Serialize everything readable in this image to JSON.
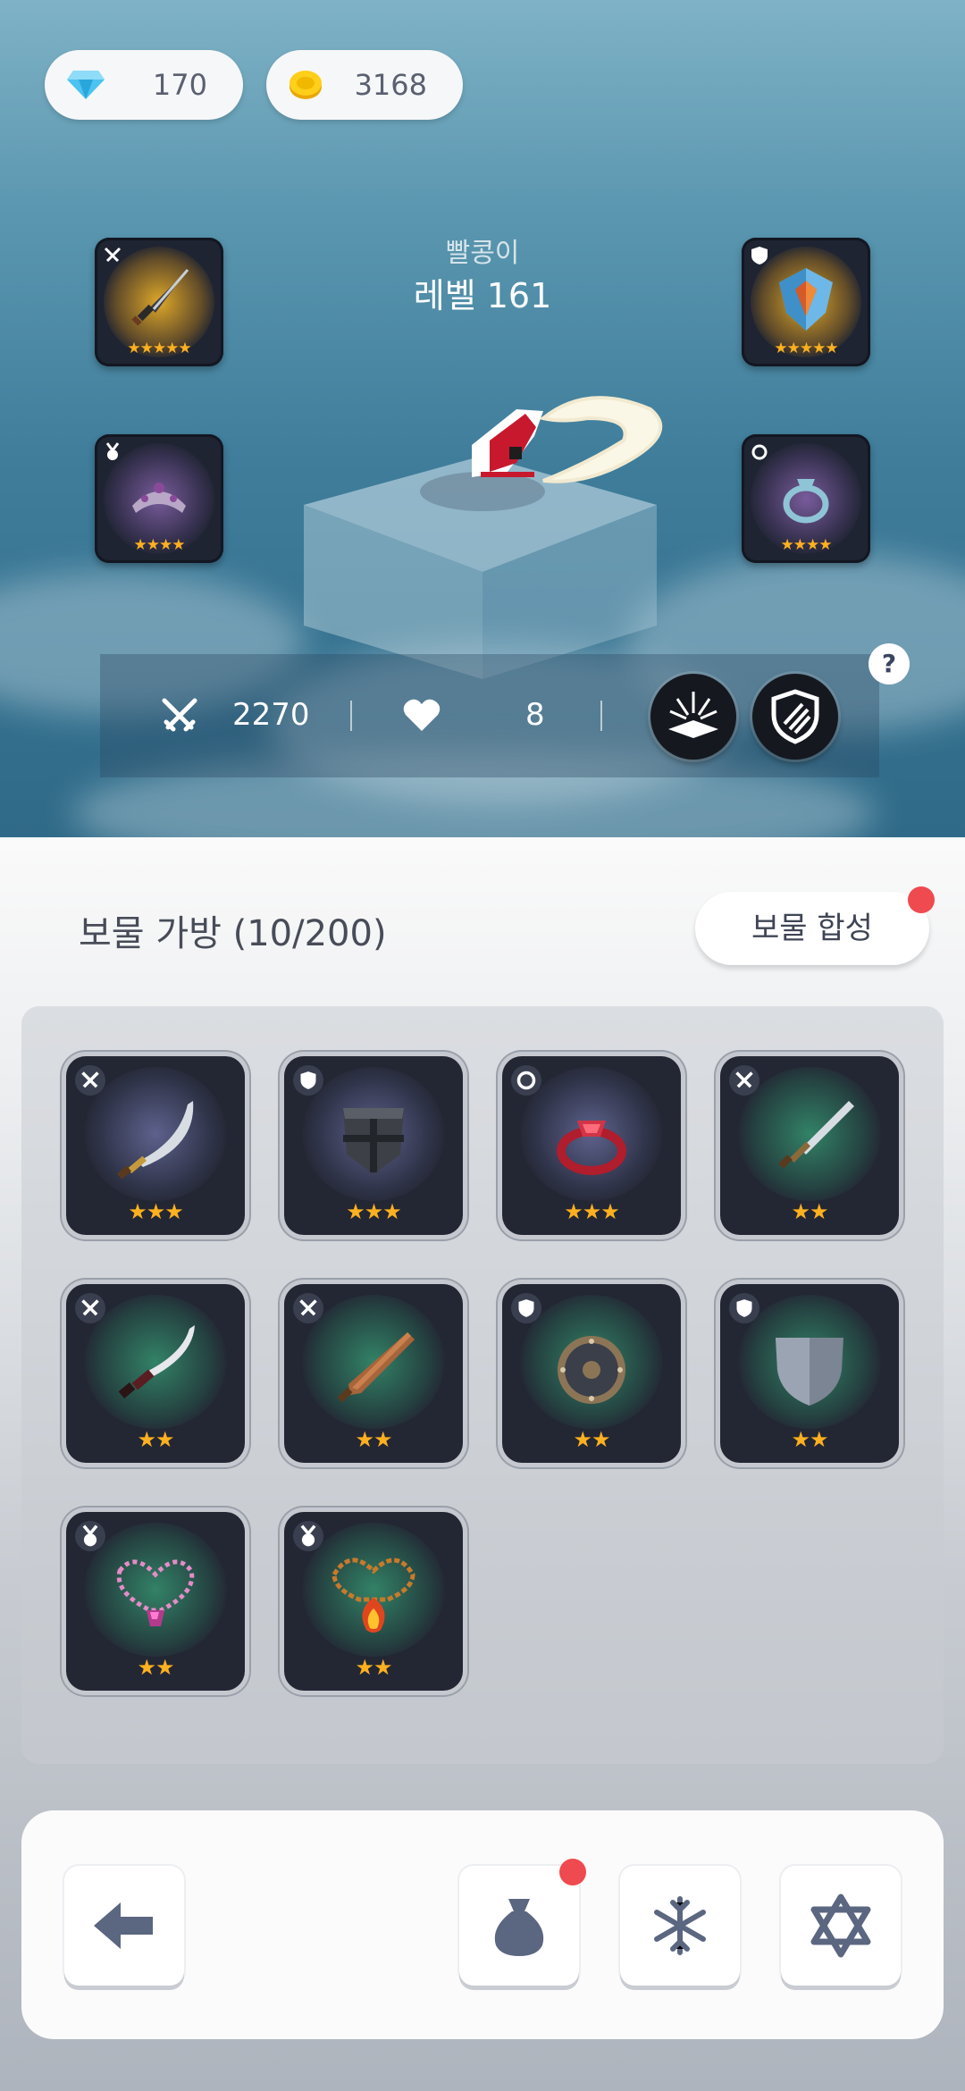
{
  "currency": {
    "gems": "170",
    "gold": "3168"
  },
  "hero": {
    "name": "빨콩이",
    "level": "레벨 161"
  },
  "equipped": [
    {
      "slot": "weapon",
      "stars": "★★★★★",
      "icon": "dagger-icon"
    },
    {
      "slot": "armor",
      "stars": "★★★★★",
      "icon": "crystal-shield-icon"
    },
    {
      "slot": "necklace",
      "stars": "★★★★",
      "icon": "tiara-icon"
    },
    {
      "slot": "ring",
      "stars": "★★★★",
      "icon": "ring-icon"
    }
  ],
  "stats": {
    "attack": "2270",
    "health": "8"
  },
  "help": "?",
  "bag": {
    "title": "보물 가방 (10/200)",
    "combine_button": "보물 합성",
    "items": [
      {
        "type": "weapon",
        "name": "scimitar",
        "stars": "★★★",
        "glow": "#5a5e8a"
      },
      {
        "type": "armor",
        "name": "iron-shield",
        "stars": "★★★",
        "glow": "#5a5e8a"
      },
      {
        "type": "ring",
        "name": "ruby-ring",
        "stars": "★★★",
        "glow": "#5a5e8a"
      },
      {
        "type": "weapon",
        "name": "short-sword",
        "stars": "★★",
        "glow": "#2f7a62"
      },
      {
        "type": "weapon",
        "name": "curved-blade",
        "stars": "★★",
        "glow": "#2f7a62"
      },
      {
        "type": "weapon",
        "name": "wooden-club",
        "stars": "★★",
        "glow": "#2f7a62"
      },
      {
        "type": "armor",
        "name": "round-buckler",
        "stars": "★★",
        "glow": "#2f7a62"
      },
      {
        "type": "armor",
        "name": "steel-shield",
        "stars": "★★",
        "glow": "#2f7a62"
      },
      {
        "type": "necklace",
        "name": "amethyst-necklace",
        "stars": "★★",
        "glow": "#2f7a62"
      },
      {
        "type": "necklace",
        "name": "fire-necklace",
        "stars": "★★",
        "glow": "#2f7a62"
      }
    ]
  },
  "colors": {
    "star": "#ffb01f",
    "notification": "#ef4a4f",
    "nav_icon": "#5b6680"
  }
}
